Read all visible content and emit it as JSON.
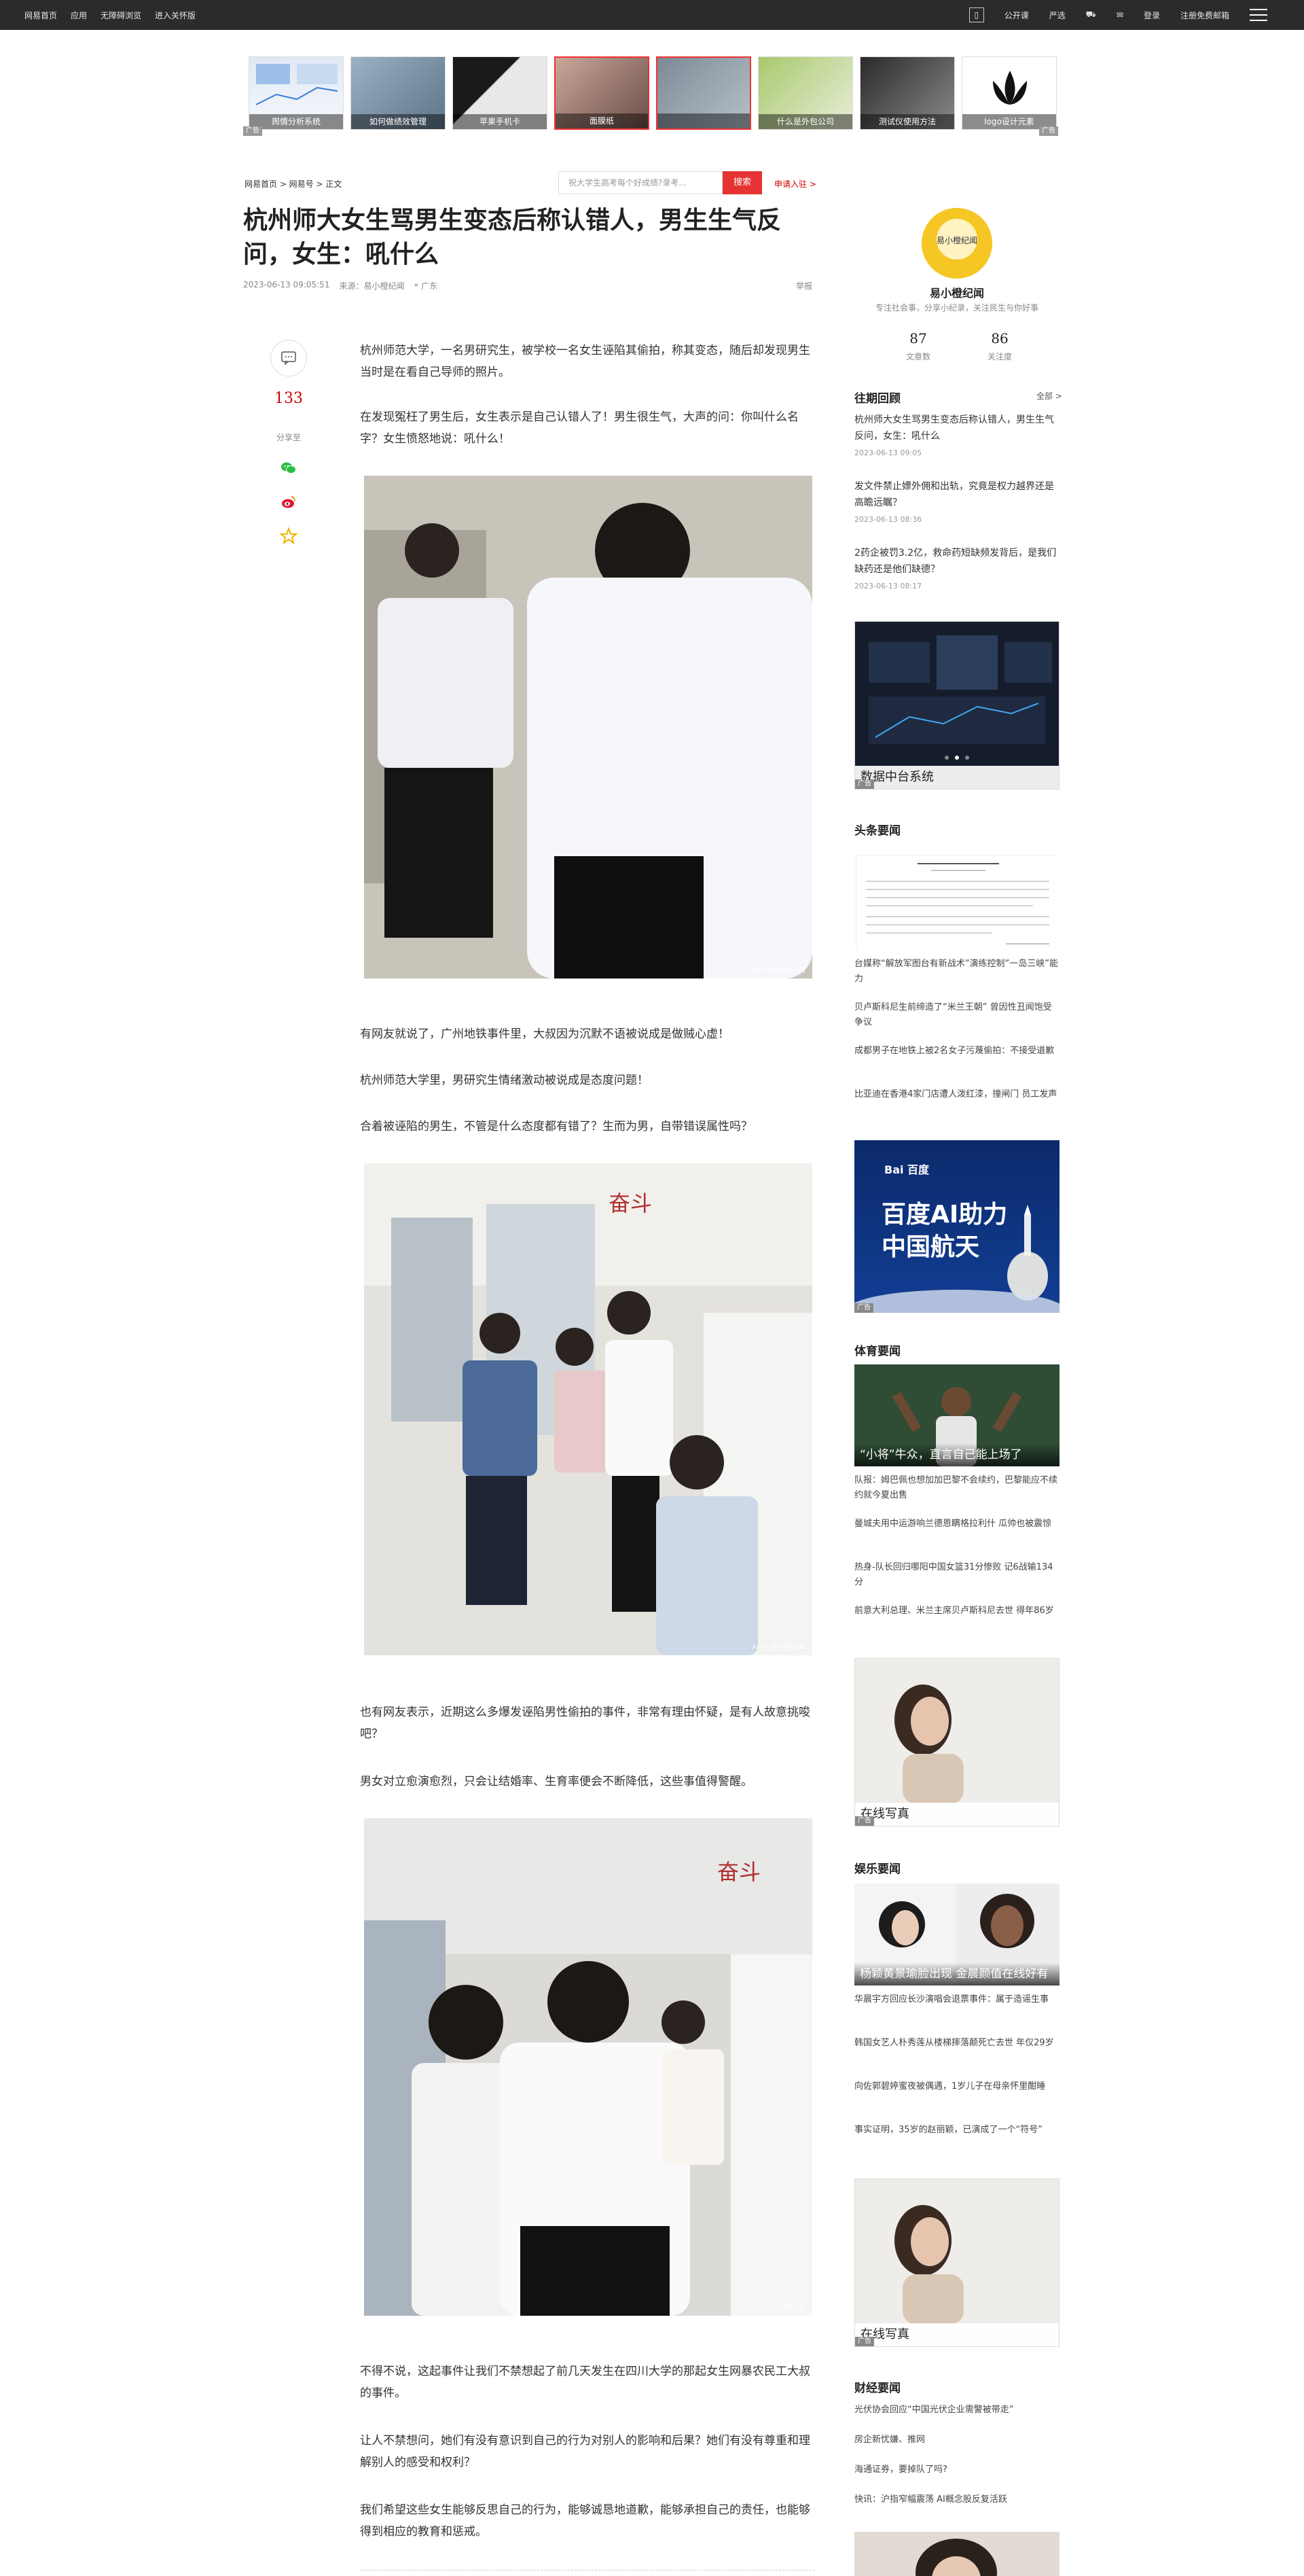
{
  "topbar": {
    "left": [
      "网易首页",
      "应用",
      "无障碍浏览",
      "进入关怀版"
    ],
    "right": [
      "公开课",
      "严选",
      "",
      "",
      "登录",
      "注册免费邮箱"
    ]
  },
  "adstrip": {
    "items": [
      "舆情分析系统",
      "如何做绩效管理",
      "苹果手机卡",
      "面膜纸",
      "",
      "什么是外包公司",
      "测试仪使用方法",
      "logo设计元素"
    ],
    "ad_label": "广告"
  },
  "breadcrumb": "网易首页 > 网易号 > 正文",
  "search": {
    "placeholder": "祝大学生高考每个好成绩?录考...",
    "button": "搜索"
  },
  "apply_link": "申请入驻 >",
  "article": {
    "title": "杭州师大女生骂男生变态后称认错人，男生生气反问，女生：吼什么",
    "time": "2023-06-13 09:05:51",
    "source": "来源：易小橙纪闻",
    "location": "广东",
    "report": "举报",
    "comment_count": "133",
    "share_label": "分享至",
    "paragraphs": [
      "杭州师范大学，一名男研究生，被学校一名女生诬陷其偷拍，称其变态，随后却发现男生当时是在看自己导师的照片。",
      "在发现冤枉了男生后，女生表示是自己认错人了！男生很生气，大声的问：你叫什么名字？女生愤怒地说：吼什么！",
      "有网友就说了，广州地铁事件里，大叔因为沉默不语被说成是做贼心虚！",
      "杭州师范大学里，男研究生情绪激动被说成是态度问题！",
      "合着被诬陷的男生，不管是什么态度都有错了？生而为男，自带错误属性吗？",
      "也有网友表示，近期这么多爆发诬陷男性偷拍的事件，非常有理由怀疑，是有人故意挑唆吧？",
      "男女对立愈演愈烈，只会让结婚率、生育率便会不断降低，这些事值得警醒。",
      "不得不说，这起事件让我们不禁想起了前几天发生在四川大学的那起女生网暴农民工大叔的事件。",
      "让人不禁想问，她们有没有意识到自己的行为对别人的影响和后果？她们有没有尊重和理解别人的感受和权利？",
      "我们希望这些女生能够反思自己的行为，能够诚恳地道歉，能够承担自己的责任，也能够得到相应的教育和惩戒。"
    ],
    "photo_watermark": "APP | 易小橙纪闻"
  },
  "sidebar": {
    "profile": {
      "avatar_text": "易小橙纪闻",
      "name": "易小橙纪闻",
      "desc": "专注社会事，分享小纪录，关注民生与你好事",
      "articles": "87",
      "articles_label": "文章数",
      "fans": "86",
      "fans_label": "关注度"
    },
    "past": {
      "heading": "往期回顾",
      "more": "全部 >",
      "items": [
        {
          "title": "杭州师大女生骂男生变态后称认错人，男生生气反问，女生：吼什么",
          "time": "2023-06-13 09:05"
        },
        {
          "title": "发文件禁止嫖外佣和出轨，究竟是权力越界还是高瞻远瞩？",
          "time": "2023-06-13 08:36"
        },
        {
          "title": "2药企被罚3.2亿，救命药短缺频发背后，是我们缺药还是他们缺德？",
          "time": "2023-06-13 08:17"
        }
      ]
    },
    "ad1_caption": "数据中台系统",
    "headline": {
      "heading": "头条要闻",
      "items": [
        "台媒称“解放军图台有新战术”演练控制”一岛三峡”能力",
        "贝卢斯科尼生前缔造了“米兰王朝” 曾因性丑闻饱受争议",
        "成都男子在地铁上被2名女子污蔑偷拍：不接受道歉",
        "比亚迪在香港4家门店遭人泼红漆，撞闸门 员工发声"
      ]
    },
    "ad2": {
      "brand": "Bai 百度",
      "line1": "百度AI助力",
      "line2": "中国航天"
    },
    "sports": {
      "heading": "体育要闻",
      "image_caption": "“小将”牛众，直言自己能上场了",
      "items": [
        "队报：姆巴佩也想加加巴黎不会续约，巴黎能应不续约就今夏出售",
        "曼城夫用中运游响兰德恩瞒格拉利什 瓜帅也被震惊",
        "热身-队长回归哪阳中国女篮31分惨败 记6战输134分",
        "前意大利总理、米兰主席贝卢斯科尼去世 得年86岁"
      ]
    },
    "ad3_caption": "在线写真",
    "ent": {
      "heading": "娱乐要闻",
      "image_caption": "杨颖黄景瑜脸出现 金晨颜值在线好有爱",
      "items": [
        "华晨宇方回应长沙演唱会退票事件：属于造谣生事",
        "韩国女艺人朴秀莲从楼梯摔落颠死亡去世 年仅29岁",
        "向佐郭碧婷蜜夜被偶遇，1岁儿子在母亲怀里酣睡",
        "事实证明，35岁的赵丽颖，已演成了一个“符号”"
      ]
    },
    "ad4_caption": "在线写真",
    "finance": {
      "heading": "财经要闻",
      "items": [
        "光伏协会回应“中国光伏企业需警被带走”",
        "房企新忧嫌、推网",
        "海通证券，要掉队了吗?",
        "快讯：沪指窄幅震荡 AI概念股反复活跃"
      ]
    }
  },
  "colors": {
    "accent": "#e53333",
    "topbar": "#2b2b2b"
  }
}
